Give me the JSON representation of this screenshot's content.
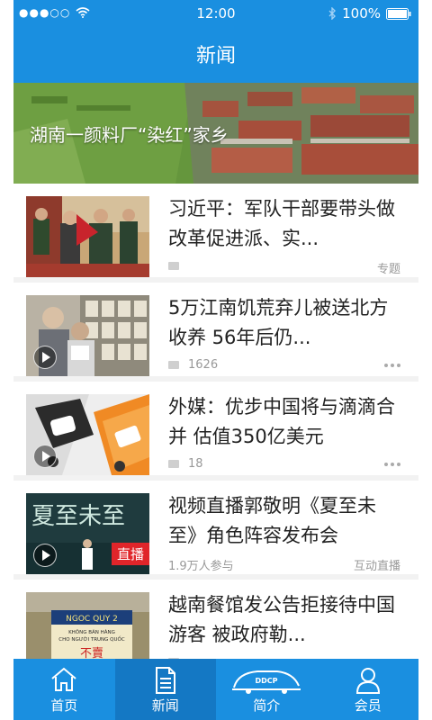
{
  "status_bar": {
    "time": "12:00",
    "battery": "100%"
  },
  "nav": {
    "title": "新闻"
  },
  "banner": {
    "caption": "湖南一颜料厂“染红”家乡"
  },
  "news": [
    {
      "title": "习近平：军队干部要带头做改革促进派、实...",
      "comments": "",
      "right_text": "专题"
    },
    {
      "title": "5万江南饥荒弃儿被送北方收养 56年后仍...",
      "comments": "1626",
      "right_text": ""
    },
    {
      "title": "外媒：优步中国将与滴滴合并 估值350亿美元",
      "comments": "18",
      "right_text": ""
    },
    {
      "title": "视频直播郭敬明《夏至未至》角色阵容发布会",
      "comments": "1.9万人参与",
      "right_text": "互动直播",
      "badge": "直播"
    },
    {
      "title": "越南餐馆发公告拒接待中国游客 被政府勒...",
      "comments": "",
      "right_text": ""
    }
  ],
  "thumb_text": {
    "poster_title": "夏至未至",
    "sign_name": "NGOC QUY 2",
    "sign_line1": "KHÔNG BÁN HÀNG",
    "sign_line2": "CHO NGƯỜI TRUNG QUỐC",
    "sign_line3": "不賣"
  },
  "tabs": [
    {
      "label": "首页",
      "icon": "home-icon"
    },
    {
      "label": "新闻",
      "icon": "news-icon"
    },
    {
      "label": "简介",
      "icon": "car-logo-icon",
      "logo_text": "DDCP"
    },
    {
      "label": "会员",
      "icon": "user-icon"
    }
  ],
  "colors": {
    "primary": "#1a8fe0",
    "tab_active": "#1478c4",
    "live_badge": "#e0252a"
  }
}
